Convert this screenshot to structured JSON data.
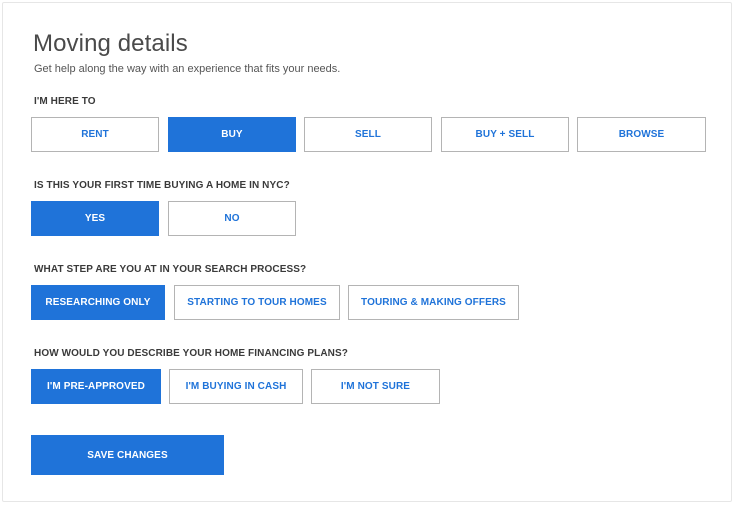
{
  "header": {
    "title": "Moving details",
    "subtitle": "Get help along the way with an experience that fits your needs."
  },
  "questions": [
    {
      "label": "I'M HERE TO",
      "options": [
        "RENT",
        "BUY",
        "SELL",
        "BUY + SELL",
        "BROWSE"
      ],
      "selected": "BUY"
    },
    {
      "label": "IS THIS YOUR FIRST TIME BUYING A HOME IN NYC?",
      "options": [
        "YES",
        "NO"
      ],
      "selected": "YES"
    },
    {
      "label": "WHAT STEP ARE YOU AT IN YOUR SEARCH PROCESS?",
      "options": [
        "RESEARCHING ONLY",
        "STARTING TO TOUR HOMES",
        "TOURING & MAKING OFFERS"
      ],
      "selected": "RESEARCHING ONLY"
    },
    {
      "label": "HOW WOULD YOU DESCRIBE YOUR HOME FINANCING PLANS?",
      "options": [
        "I'M PRE-APPROVED",
        "I'M BUYING IN CASH",
        "I'M NOT SURE"
      ],
      "selected": "I'M PRE-APPROVED"
    }
  ],
  "actions": {
    "save_label": "SAVE CHANGES"
  },
  "colors": {
    "accent": "#1f73d9",
    "border": "#b4b4b4",
    "text": "#3a3a3a"
  }
}
